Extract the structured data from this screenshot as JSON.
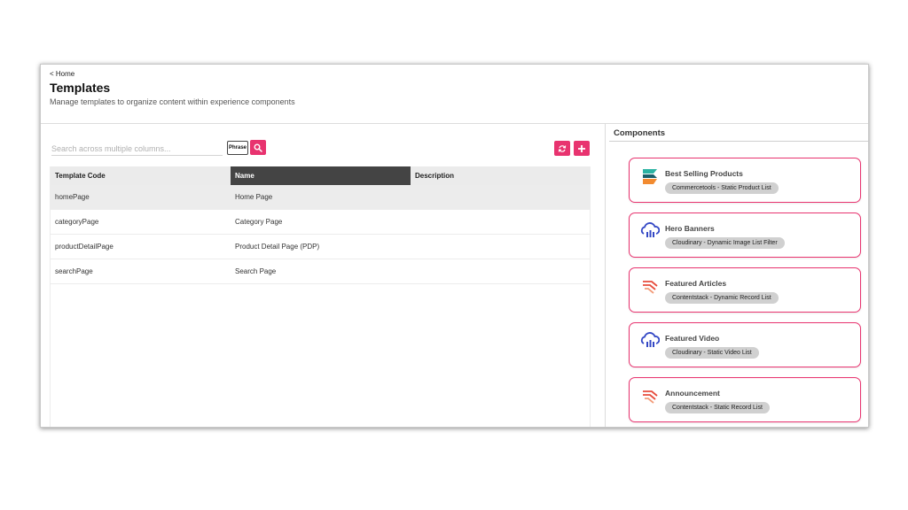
{
  "header": {
    "back_label": "< Home",
    "title": "Templates",
    "subtitle": "Manage templates to organize content within experience components"
  },
  "search": {
    "placeholder": "Search across multiple columns...",
    "value": "",
    "phrase_label": "Phrase"
  },
  "table": {
    "columns": {
      "code": "Template Code",
      "name": "Name",
      "description": "Description"
    },
    "rows": [
      {
        "code": "homePage",
        "name": "Home Page",
        "description": ""
      },
      {
        "code": "categoryPage",
        "name": "Category Page",
        "description": ""
      },
      {
        "code": "productDetailPage",
        "name": "Product Detail Page (PDP)",
        "description": ""
      },
      {
        "code": "searchPage",
        "name": "Search Page",
        "description": ""
      }
    ]
  },
  "components": {
    "header": "Components",
    "items": [
      {
        "name": "Best Selling Products",
        "tag": "Commercetools - Static Product List",
        "icon": "commercetools-icon"
      },
      {
        "name": "Hero Banners",
        "tag": "Cloudinary - Dynamic Image List Filter",
        "icon": "cloudinary-icon"
      },
      {
        "name": "Featured Articles",
        "tag": "Contentstack - Dynamic Record List",
        "icon": "contentstack-icon"
      },
      {
        "name": "Featured Video",
        "tag": "Cloudinary - Static Video List",
        "icon": "cloudinary-icon"
      },
      {
        "name": "Announcement",
        "tag": "Contentstack - Static Record List",
        "icon": "contentstack-icon"
      }
    ]
  },
  "colors": {
    "accent": "#e8336f",
    "header_selected": "#444444",
    "cloudinary_blue": "#3448c5",
    "contentstack_red": "#e74c3c"
  }
}
